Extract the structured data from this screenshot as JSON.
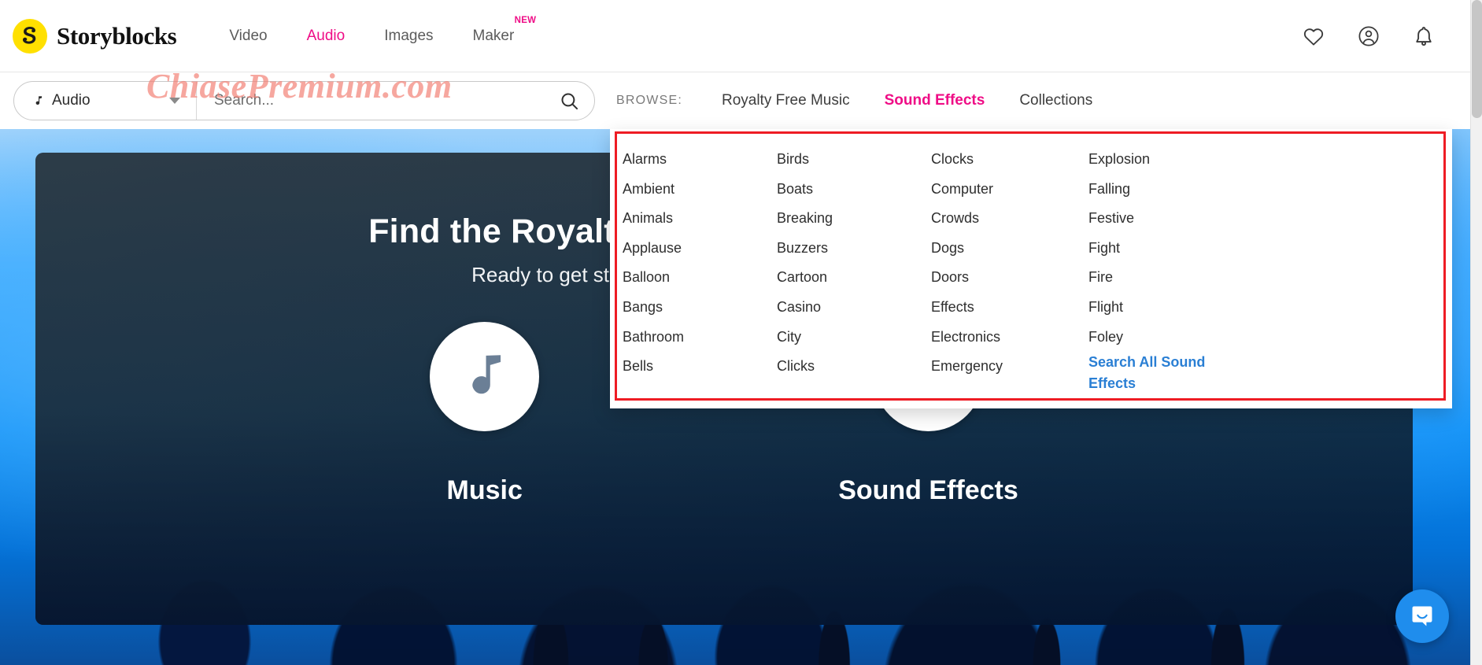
{
  "brand": {
    "name": "Storyblocks",
    "logo_icon": "storyblocks-s-icon"
  },
  "nav": {
    "links": [
      {
        "label": "Video",
        "active": false
      },
      {
        "label": "Audio",
        "active": true
      },
      {
        "label": "Images",
        "active": false
      },
      {
        "label": "Maker",
        "active": false,
        "badge": "NEW"
      }
    ],
    "icons": [
      {
        "name": "heart-icon",
        "label": "Favorites"
      },
      {
        "name": "account-icon",
        "label": "Account"
      },
      {
        "name": "bell-icon",
        "label": "Notifications"
      }
    ]
  },
  "search": {
    "type_value": "Audio",
    "type_icon": "music-note-icon",
    "placeholder": "Search...",
    "value": "",
    "submit_icon": "search-icon"
  },
  "browse": {
    "label": "BROWSE:",
    "links": [
      {
        "label": "Royalty Free Music",
        "active": false
      },
      {
        "label": "Sound Effects",
        "active": true
      },
      {
        "label": "Collections",
        "active": false
      }
    ]
  },
  "hero": {
    "title": "Find the Royalty-free Stock Audio You Need",
    "subtitle": "Ready to get started? Select the type of audio you need",
    "choices": [
      {
        "label": "Music",
        "icon": "music-note-icon"
      },
      {
        "label": "Sound Effects",
        "icon": "speaker-icon"
      }
    ]
  },
  "mega_menu": {
    "columns": [
      {
        "items": [
          "Alarms",
          "Ambient",
          "Animals",
          "Applause",
          "Balloon",
          "Bangs",
          "Bathroom",
          "Bells"
        ]
      },
      {
        "items": [
          "Birds",
          "Boats",
          "Breaking",
          "Buzzers",
          "Cartoon",
          "Casino",
          "City",
          "Clicks"
        ]
      },
      {
        "items": [
          "Clocks",
          "Computer",
          "Crowds",
          "Dogs",
          "Doors",
          "Effects",
          "Electronics",
          "Emergency"
        ]
      },
      {
        "items": [
          "Explosion",
          "Falling",
          "Festive",
          "Fight",
          "Fire",
          "Flight",
          "Foley"
        ]
      }
    ],
    "search_all_link": "Search All Sound Effects",
    "highlight_color": "#ee1c24",
    "link_color": "#2a7fd4"
  },
  "watermark": {
    "text": "ChiasePremium.com"
  },
  "chat": {
    "icon": "chat-bubble-icon",
    "color": "#1f8ded"
  },
  "theme": {
    "accent_pink": "#ef0d86",
    "brand_yellow": "#ffe000",
    "link_blue": "#2a7fd4"
  }
}
